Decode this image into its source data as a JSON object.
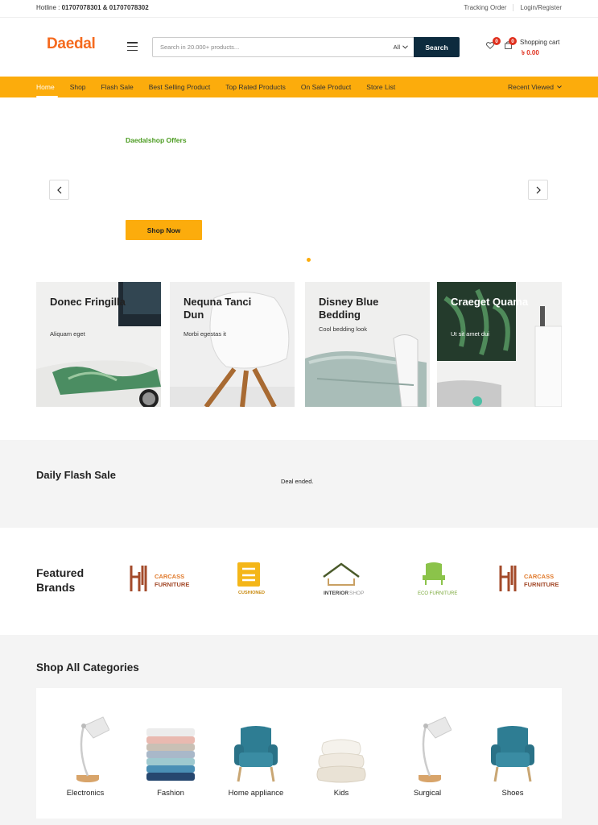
{
  "topbar": {
    "hotline_label": "Hotline :",
    "hotline_numbers": "01707078301 & 01707078302",
    "tracking_order": "Tracking Order",
    "login_register": "Login/Register"
  },
  "header": {
    "logo": "Daedal",
    "search_placeholder": "Search in 20.000+ products...",
    "search_category": "All",
    "search_button": "Search",
    "wishlist_count": "0",
    "cart_count": "0",
    "cart_label": "Shopping cart",
    "cart_total": "৳ 0.00"
  },
  "nav": {
    "items": [
      "Home",
      "Shop",
      "Flash Sale",
      "Best Selling Product",
      "Top Rated Products",
      "On Sale Product",
      "Store List"
    ],
    "recent_viewed": "Recent Viewed"
  },
  "hero": {
    "offer_text": "Daedalshop Offers",
    "cta": "Shop Now",
    "slide_index": 1
  },
  "promo_cards": [
    {
      "title": "Donec Fringilla",
      "subtitle": "Aliquam eget"
    },
    {
      "title": "Nequna Tanci Dun",
      "subtitle": "Morbi egestas it"
    },
    {
      "title": "Disney Blue Bedding",
      "subtitle": "Cool bedding look"
    },
    {
      "title": "Craeget Quama",
      "subtitle": "Ut sit amet dui"
    }
  ],
  "flash_sale": {
    "title": "Daily Flash Sale",
    "status": "Deal ended."
  },
  "brands": {
    "title": "Featured Brands",
    "items": [
      {
        "name": "CARCASS FURNITURE",
        "line1": "CARCASS",
        "line2": "FURNITURE"
      },
      {
        "name": "CUSHIONED",
        "line1": "CUSHIONED",
        "line2": ""
      },
      {
        "name": "INTERIOR SHOP",
        "line1": "INTERIOR",
        "line2": "SHOP"
      },
      {
        "name": "ECO FURNITURE",
        "line1": "ECO FURNITURE",
        "line2": ""
      },
      {
        "name": "CARCASS FURNITURE",
        "line1": "CARCASS",
        "line2": "FURNITURE"
      }
    ]
  },
  "categories": {
    "title": "Shop All Categories",
    "items": [
      {
        "label": "Electronics",
        "icon": "desk-lamp-icon"
      },
      {
        "label": "Fashion",
        "icon": "folded-towels-icon"
      },
      {
        "label": "Home appliance",
        "icon": "armchair-icon"
      },
      {
        "label": "Kids",
        "icon": "pillows-icon"
      },
      {
        "label": "Surgical",
        "icon": "desk-lamp-icon"
      },
      {
        "label": "Shoes",
        "icon": "armchair-icon"
      }
    ]
  },
  "colors": {
    "accent": "#fcac0c",
    "logo": "#f56a1e",
    "search_button": "#0d2b3e",
    "badge": "#e0301e",
    "offer_text": "#4a9b1f"
  }
}
